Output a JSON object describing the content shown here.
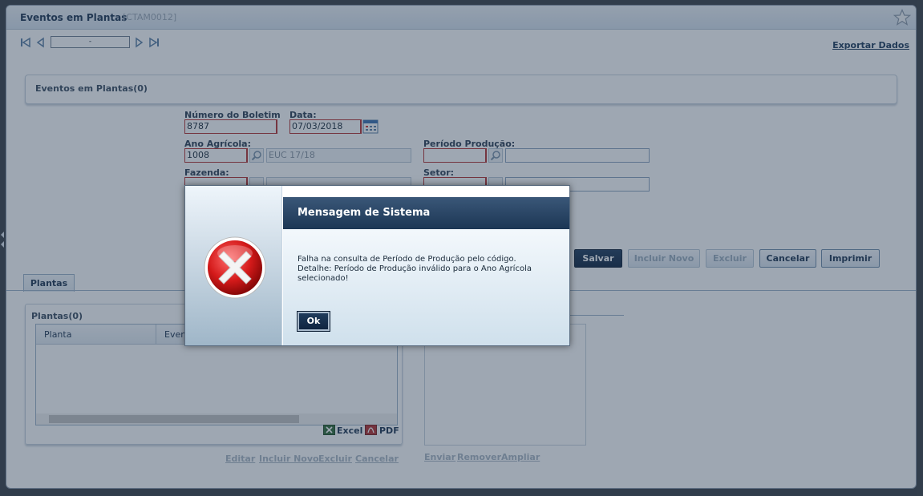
{
  "window": {
    "title": "Eventos em Plantas",
    "code": "[CTAM0012]"
  },
  "nav": {
    "record_value": "-",
    "export_label": "Exportar Dados"
  },
  "header_panel": {
    "title": "Eventos em Plantas(0)"
  },
  "form": {
    "numero_boletim_label": "Número do Boletim",
    "numero_boletim_value": "8787",
    "data_label": "Data:",
    "data_value": "07/03/2018",
    "ano_agricola_label": "Ano Agrícola:",
    "ano_agricola_value": "1008",
    "ano_agricola_desc": "EUC 17/18",
    "periodo_producao_label": "Período Produção:",
    "periodo_producao_value": "",
    "periodo_producao_desc": "",
    "fazenda_label": "Fazenda:",
    "fazenda_value": "",
    "fazenda_desc": "",
    "setor_label": "Setor:",
    "setor_value": "",
    "setor_desc": ""
  },
  "actions": {
    "salvar": "Salvar",
    "incluir_novo": "Incluir Novo",
    "excluir": "Excluir",
    "cancelar": "Cancelar",
    "imprimir": "Imprimir"
  },
  "tabs": [
    {
      "label": "Plantas",
      "active": true
    }
  ],
  "plantas_box": {
    "title": "Plantas(0)",
    "columns": [
      "Planta",
      "Event"
    ],
    "excel_label": "Excel",
    "pdf_label": "PDF",
    "links": [
      "Editar",
      "Incluir Novo",
      "Excluir",
      "Cancelar"
    ]
  },
  "right_links": [
    "Enviar",
    "Remover",
    "Ampliar"
  ],
  "dialog": {
    "title": "Mensagem de Sistema",
    "message_line1": "Falha na consulta de Período de Produção pelo código.",
    "message_line2": "Detalhe: Período de Produção inválido para o Ano Agrícola selecionado!",
    "ok_label": "Ok",
    "icon": "error-icon"
  },
  "colors": {
    "primary_button": "#1f3b5c",
    "required_border": "#d02020",
    "dialog_header": "#2b4767",
    "error_red": "#d41a1a"
  }
}
